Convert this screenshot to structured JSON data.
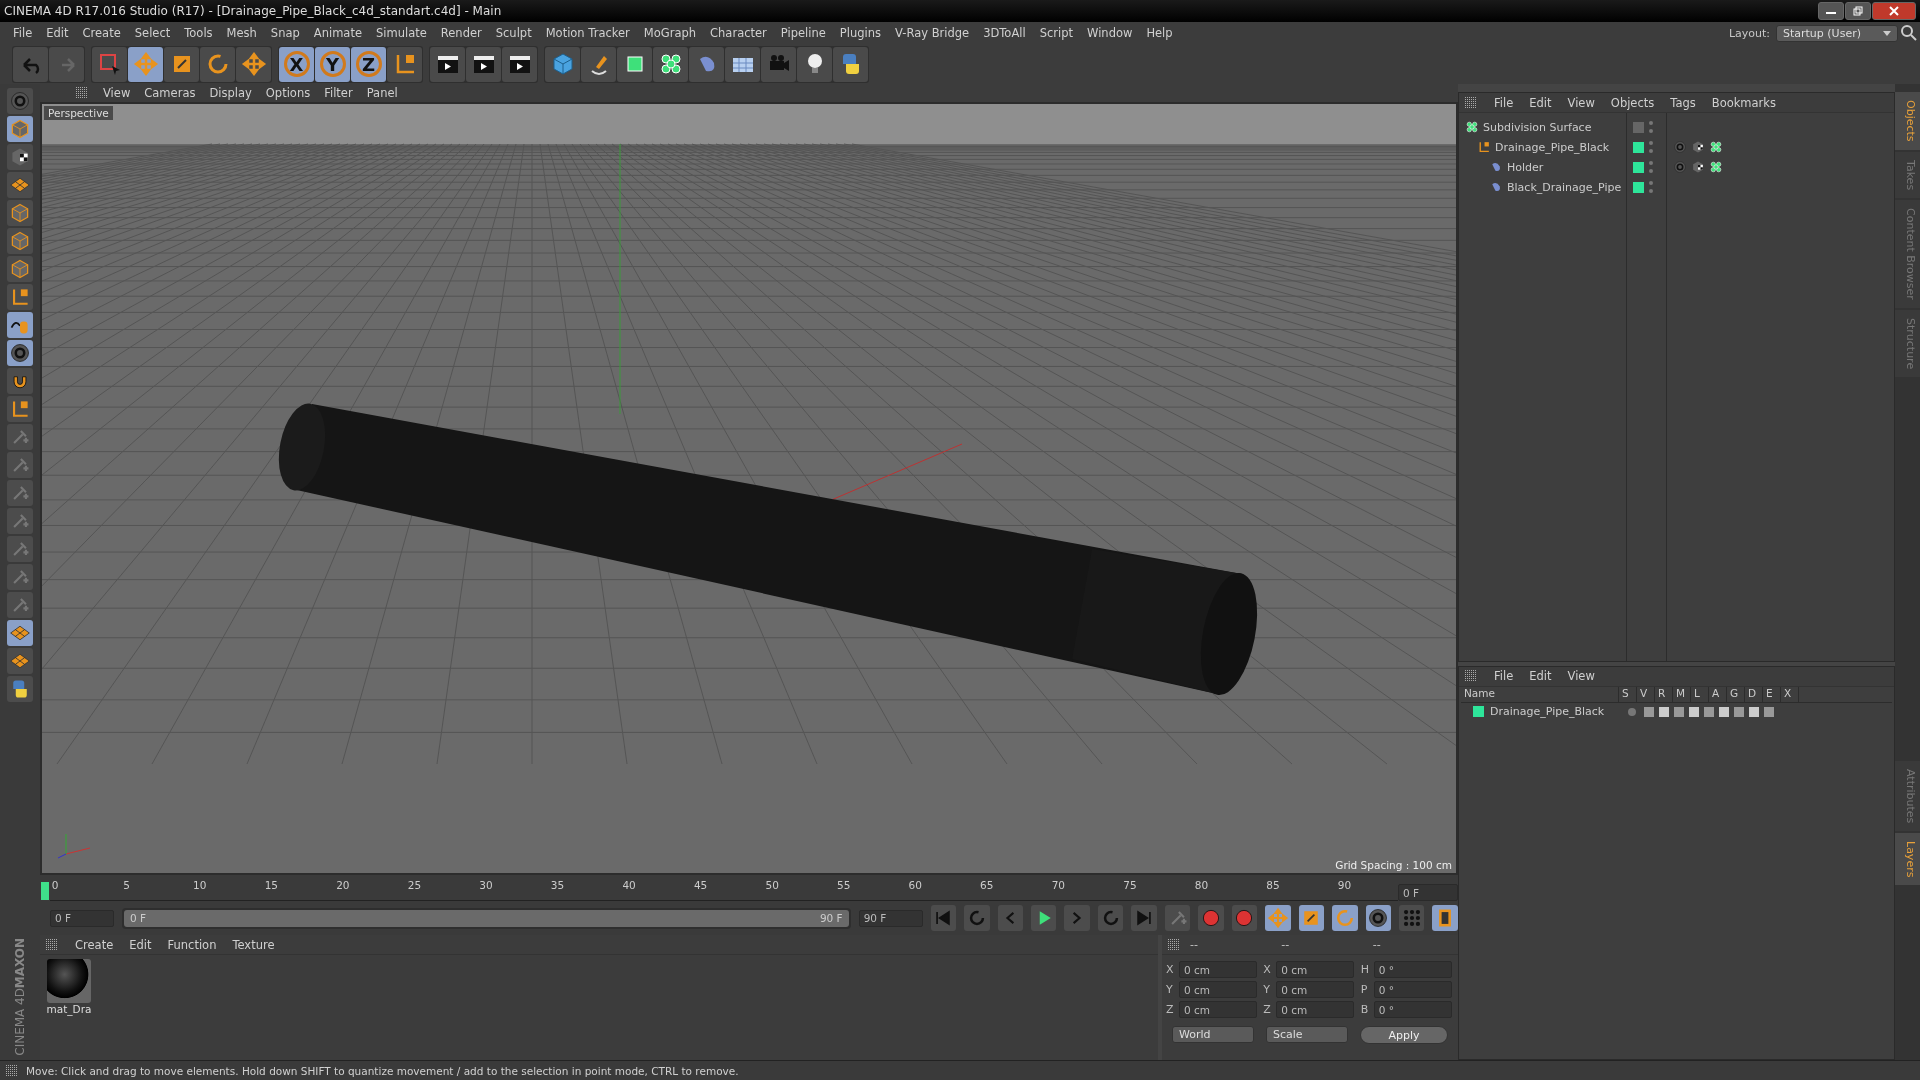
{
  "window": {
    "title": "CINEMA 4D R17.016 Studio (R17) - [Drainage_Pipe_Black_c4d_standart.c4d] - Main"
  },
  "menu": [
    "File",
    "Edit",
    "Create",
    "Select",
    "Tools",
    "Mesh",
    "Snap",
    "Animate",
    "Simulate",
    "Render",
    "Sculpt",
    "Motion Tracker",
    "MoGraph",
    "Character",
    "Pipeline",
    "Plugins",
    "V-Ray Bridge",
    "3DToAll",
    "Script",
    "Window",
    "Help"
  ],
  "layout": {
    "label": "Layout:",
    "value": "Startup (User)"
  },
  "axis_buttons": [
    "X",
    "Y",
    "Z"
  ],
  "viewport": {
    "menu": [
      "View",
      "Cameras",
      "Display",
      "Options",
      "Filter",
      "Panel"
    ],
    "camera": "Perspective",
    "grid_spacing": "Grid Spacing : 100 cm"
  },
  "timeline": {
    "ticks": [
      "0",
      "5",
      "10",
      "15",
      "20",
      "25",
      "30",
      "35",
      "40",
      "45",
      "50",
      "55",
      "60",
      "65",
      "70",
      "75",
      "80",
      "85",
      "90"
    ],
    "current_frame": "0 F",
    "start_field": "0 F",
    "range": {
      "start": "0 F",
      "end": "90 F",
      "level": 1
    },
    "end_field": "90 F"
  },
  "materials": {
    "menu": [
      "Create",
      "Edit",
      "Function",
      "Texture"
    ],
    "items": [
      {
        "name": "mat_Dra"
      }
    ]
  },
  "brand": [
    "MAXON",
    "CINEMA 4D"
  ],
  "coordinates": {
    "headers": [
      "--",
      "--",
      "--"
    ],
    "rows": [
      [
        {
          "label": "X",
          "value": "0 cm"
        },
        {
          "label": "X",
          "value": "0 cm"
        },
        {
          "label": "H",
          "value": "0 °"
        }
      ],
      [
        {
          "label": "Y",
          "value": "0 cm"
        },
        {
          "label": "Y",
          "value": "0 cm"
        },
        {
          "label": "P",
          "value": "0 °"
        }
      ],
      [
        {
          "label": "Z",
          "value": "0 cm"
        },
        {
          "label": "Z",
          "value": "0 cm"
        },
        {
          "label": "B",
          "value": "0 °"
        }
      ]
    ],
    "space": "World",
    "mode": "Scale",
    "apply": "Apply"
  },
  "objects": {
    "menu": [
      "File",
      "Edit",
      "View",
      "Objects",
      "Tags",
      "Bookmarks"
    ],
    "tree": [
      {
        "name": "Subdivision Surface",
        "kind": "generator",
        "children": [
          {
            "name": "Drainage_Pipe_Black",
            "kind": "null",
            "children": [
              {
                "name": "Holder",
                "kind": "mesh"
              },
              {
                "name": "Black_Drainage_Pipe",
                "kind": "mesh"
              }
            ]
          }
        ]
      }
    ]
  },
  "layers": {
    "menu": [
      "File",
      "Edit",
      "View"
    ],
    "columns": [
      "Name",
      "S",
      "V",
      "R",
      "M",
      "L",
      "A",
      "G",
      "D",
      "E",
      "X"
    ],
    "rows": [
      {
        "name": "Drainage_Pipe_Black",
        "color": "#2ee59a"
      }
    ]
  },
  "side_tabs_top": [
    {
      "label": "Objects",
      "selected": true
    },
    {
      "label": "Takes",
      "selected": false
    },
    {
      "label": "Content Browser",
      "selected": false
    },
    {
      "label": "Structure",
      "selected": false
    }
  ],
  "side_tabs_bottom": [
    {
      "label": "Attributes",
      "selected": false
    },
    {
      "label": "Layers",
      "selected": true
    }
  ],
  "status": "Move: Click and drag to move elements. Hold down SHIFT to quantize movement / add to the selection in point mode, CTRL to remove."
}
